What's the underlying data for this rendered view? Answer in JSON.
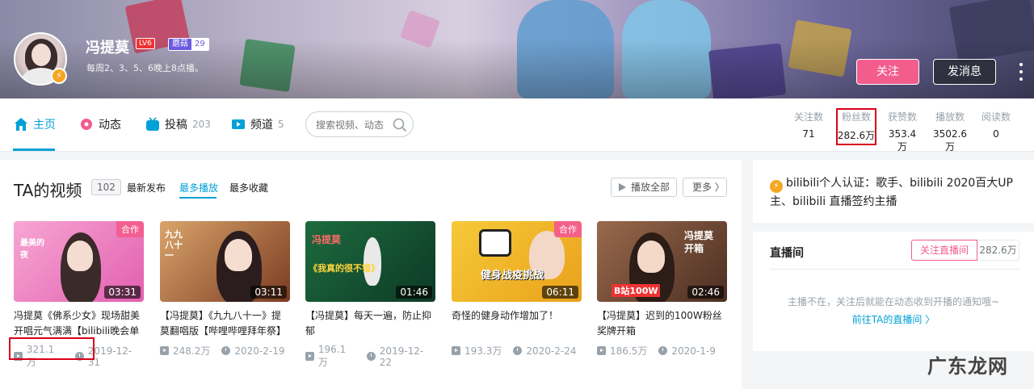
{
  "header": {
    "username": "冯提莫",
    "level": "LV6",
    "vip_label": "蘑菇",
    "vip_level": "29",
    "signature": "每周2、3、5、6晚上8点播。",
    "follow_label": "关注",
    "message_label": "发消息"
  },
  "nav": {
    "tabs": [
      {
        "label": "主页",
        "count": ""
      },
      {
        "label": "动态",
        "count": ""
      },
      {
        "label": "投稿",
        "count": "203"
      },
      {
        "label": "频道",
        "count": "5"
      }
    ],
    "search_placeholder": "搜索视频、动态"
  },
  "stats": [
    {
      "label": "关注数",
      "value": "71"
    },
    {
      "label": "粉丝数",
      "value": "282.6万"
    },
    {
      "label": "获赞数",
      "value": "353.4万"
    },
    {
      "label": "播放数",
      "value": "3502.6万"
    },
    {
      "label": "阅读数",
      "value": "0"
    }
  ],
  "videos_section": {
    "title": "TA的视频",
    "count": "102",
    "sort_options": [
      "最新发布",
      "最多播放",
      "最多收藏"
    ],
    "play_all_label": "播放全部",
    "more_label": "更多 〉"
  },
  "videos": [
    {
      "title": "冯提莫《佛系少女》现场甜美开唱元气满满【bilibili晚会单",
      "duration": "03:31",
      "tag": "合作",
      "plays": "321.1万",
      "date": "2019-12-31",
      "thumb_text": "最美的夜"
    },
    {
      "title": "【冯提莫】《九九八十一》提莫翻唱版【哔哩哔哩拜年祭】",
      "duration": "03:11",
      "tag": "",
      "plays": "248.2万",
      "date": "2020-2-19",
      "thumb_text": "九九八十一"
    },
    {
      "title": "【冯提莫】每天一遍，防止抑郁",
      "duration": "01:46",
      "tag": "",
      "plays": "196.1万",
      "date": "2019-12-22",
      "thumb_text": "《我真的很不错》"
    },
    {
      "title": "奇怪的健身动作增加了！",
      "duration": "06:11",
      "tag": "合作",
      "plays": "193.3万",
      "date": "2020-2-24",
      "thumb_text": "健身战疫挑战"
    },
    {
      "title": "【冯提莫】迟到的100W粉丝奖牌开箱",
      "duration": "02:46",
      "tag": "",
      "plays": "186.5万",
      "date": "2020-1-9",
      "thumb_text": "冯提莫开箱"
    }
  ],
  "certification": "bilibili个人认证：歌手、bilibili 2020百大UP主、bilibili 直播签约主播",
  "live": {
    "title": "直播间",
    "follow_label": "关注直播间",
    "fans": "282.6万",
    "tip": "主播不在，关注后就能在动态收到开播的通知哦~",
    "link": "前往TA的直播间 〉"
  },
  "watermark": "广东龙网"
}
